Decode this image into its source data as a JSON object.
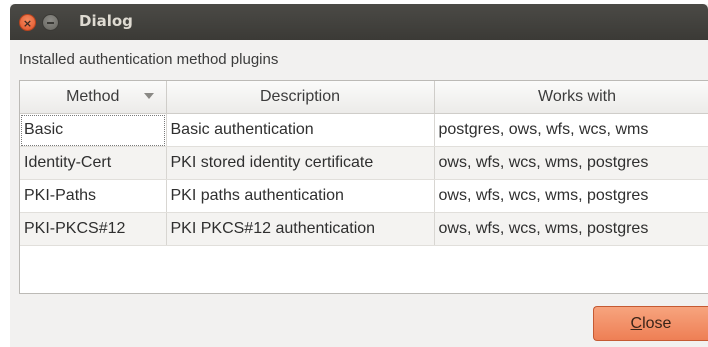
{
  "window": {
    "title": "Dialog"
  },
  "heading": "Installed authentication method plugins",
  "table": {
    "columns": [
      "Method",
      "Description",
      "Works with"
    ],
    "rows": [
      [
        "Basic",
        "Basic authentication",
        "postgres, ows, wfs, wcs, wms"
      ],
      [
        "Identity-Cert",
        "PKI stored identity certificate",
        "ows, wfs, wcs, wms, postgres"
      ],
      [
        "PKI-Paths",
        "PKI paths authentication",
        "ows, wfs, wcs, wms, postgres"
      ],
      [
        "PKI-PKCS#12",
        "PKI PKCS#12 authentication",
        "ows, wfs, wcs, wms, postgres"
      ]
    ]
  },
  "buttons": {
    "close_mnemonic": "C",
    "close_rest": "lose"
  },
  "colors": {
    "accent": "#f08a5d",
    "titlebar": "#3c3b37"
  }
}
